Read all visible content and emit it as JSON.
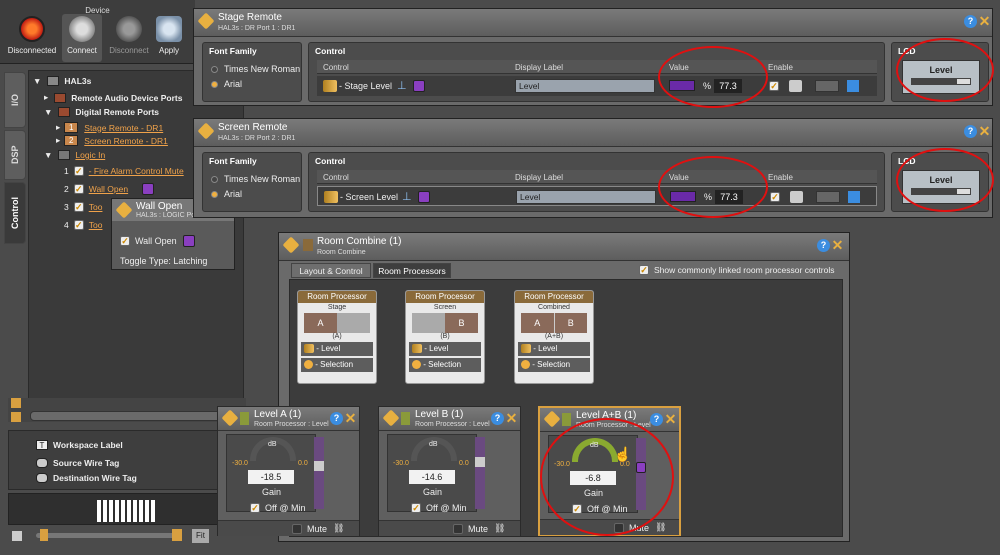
{
  "device": {
    "title": "Device"
  },
  "toolbar": {
    "disconnected": "Disconnected",
    "connect": "Connect",
    "disconnect": "Disconnect",
    "apply": "Apply"
  },
  "side_tabs": [
    "I/O",
    "DSP",
    "Control"
  ],
  "tree": {
    "root": "HAL3s",
    "remote_audio": "Remote Audio Device Ports",
    "digital_remote": "Digital Remote Ports",
    "dr1": {
      "num": "1",
      "label": "Stage Remote - DR1"
    },
    "dr2": {
      "num": "2",
      "label": "Screen Remote - DR1"
    },
    "logic_in": "Logic In",
    "logic_items": [
      {
        "num": "1",
        "label": "- Fire Alarm Control Mute"
      },
      {
        "num": "2",
        "label": "Wall Open"
      },
      {
        "num": "3",
        "label": "Too"
      },
      {
        "num": "4",
        "label": "Too"
      }
    ]
  },
  "wall_popup": {
    "title": "Wall Open",
    "subtitle": "HAL3s : LOGIC Port",
    "check_label": "Wall Open",
    "toggle": "Toggle Type: Latching"
  },
  "bottom_left": {
    "workspace_label": "Workspace Label",
    "source_wire_tag": "Source Wire Tag",
    "dest_wire_tag": "Destination Wire Tag",
    "fit": "Fit"
  },
  "stage_remote": {
    "title": "Stage Remote",
    "subtitle": "HAL3s : DR Port 1 : DR1",
    "font_family": "Font Family",
    "fonts": [
      "Times New Roman",
      "Arial"
    ],
    "selected_font": "Arial",
    "control_hdr": "Control",
    "cols": [
      "Control",
      "Display Label",
      "Value",
      "Enable"
    ],
    "row": {
      "control": "- Stage Level",
      "display_label": "Level",
      "unit": "%",
      "value": "77.3"
    },
    "lcd": "LCD",
    "lcd_text": "Level",
    "lcd_level": 0.77
  },
  "screen_remote": {
    "title": "Screen Remote",
    "subtitle": "HAL3s : DR Port 2 : DR1",
    "font_family": "Font Family",
    "fonts": [
      "Times New Roman",
      "Arial"
    ],
    "selected_font": "Arial",
    "control_hdr": "Control",
    "cols": [
      "Control",
      "Display Label",
      "Value",
      "Enable"
    ],
    "row": {
      "control": "- Screen Level",
      "display_label": "Level",
      "unit": "%",
      "value": "77.3"
    },
    "lcd": "LCD",
    "lcd_text": "Level",
    "lcd_level": 0.77
  },
  "room_combine": {
    "title": "Room Combine (1)",
    "subtitle": "Room Combine",
    "tabs": [
      "Layout & Control",
      "Room Processors"
    ],
    "show_linked": "Show commonly linked room processor controls",
    "processors": [
      {
        "header": "Room Processor",
        "name": "Stage",
        "rooms": [
          "A",
          ""
        ],
        "sub": "(A)",
        "level": "- Level",
        "selection": "- Selection"
      },
      {
        "header": "Room Processor",
        "name": "Screen",
        "rooms": [
          "",
          "B"
        ],
        "sub": "(B)",
        "level": "- Level",
        "selection": "- Selection"
      },
      {
        "header": "Room Processor",
        "name": "Combined",
        "rooms": [
          "A",
          "B"
        ],
        "sub": "(A+B)",
        "level": "- Level",
        "selection": "- Selection"
      }
    ]
  },
  "levels": [
    {
      "title": "Level A (1)",
      "subtitle": "Room Processor : Level",
      "db": "dB",
      "min": "-30.0",
      "max": "0.0",
      "value": "-18.5",
      "gain": "Gain",
      "off_min": "Off @ Min",
      "mute": "Mute"
    },
    {
      "title": "Level B (1)",
      "subtitle": "Room Processor : Level",
      "db": "dB",
      "min": "-30.0",
      "max": "0.0",
      "value": "-14.6",
      "gain": "Gain",
      "off_min": "Off @ Min",
      "mute": "Mute"
    },
    {
      "title": "Level A+B (1)",
      "subtitle": "Room Processor : Level",
      "db": "dB",
      "min": "-30.0",
      "max": "0.0",
      "value": "-6.8",
      "gain": "Gain",
      "off_min": "Off @ Min",
      "mute": "Mute"
    }
  ],
  "colors": {
    "accent": "#f0b040",
    "link": "#f0a24a",
    "purple": "#8a3fc0",
    "highlight": "#e01010"
  }
}
